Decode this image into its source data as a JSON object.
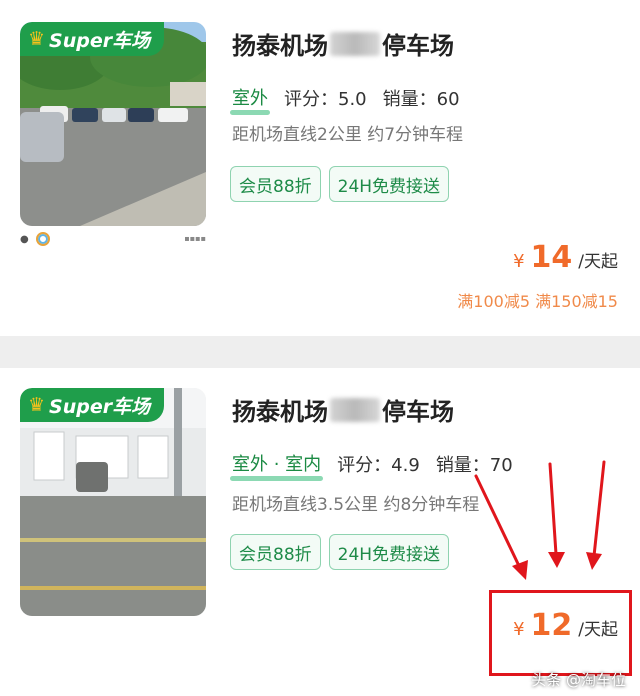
{
  "listings": [
    {
      "badge": "Super车场",
      "title_start": "扬泰机场",
      "title_end": "停车场",
      "environment": "室外",
      "rating": "评分：5.0",
      "sales": "销量：60",
      "distance": "距机场直线2公里 约7分钟车程",
      "tags": [
        "会员88折",
        "24H免费接送"
      ],
      "price_currency": "¥",
      "price_amount": "14",
      "price_unit": "/天起",
      "discounts": "满100减5 满150减15"
    },
    {
      "badge": "Super车场",
      "title_start": "扬泰机场",
      "title_end": "停车场",
      "environment": "室外 · 室内",
      "rating": "评分：4.9",
      "sales": "销量：70",
      "distance": "距机场直线3.5公里 约8分钟车程",
      "tags": [
        "会员88折",
        "24H免费接送"
      ],
      "price_currency": "¥",
      "price_amount": "12",
      "price_unit": "/天起"
    }
  ],
  "watermark": "头条 @淘车位",
  "colors": {
    "badge_green": "#1f9e4b",
    "price_orange": "#f06a2a",
    "tag_green": "#1e8b48",
    "annotation_red": "#e0161c"
  },
  "icons": {
    "badge": "crown-icon",
    "annotation": "red-arrow-icon"
  }
}
